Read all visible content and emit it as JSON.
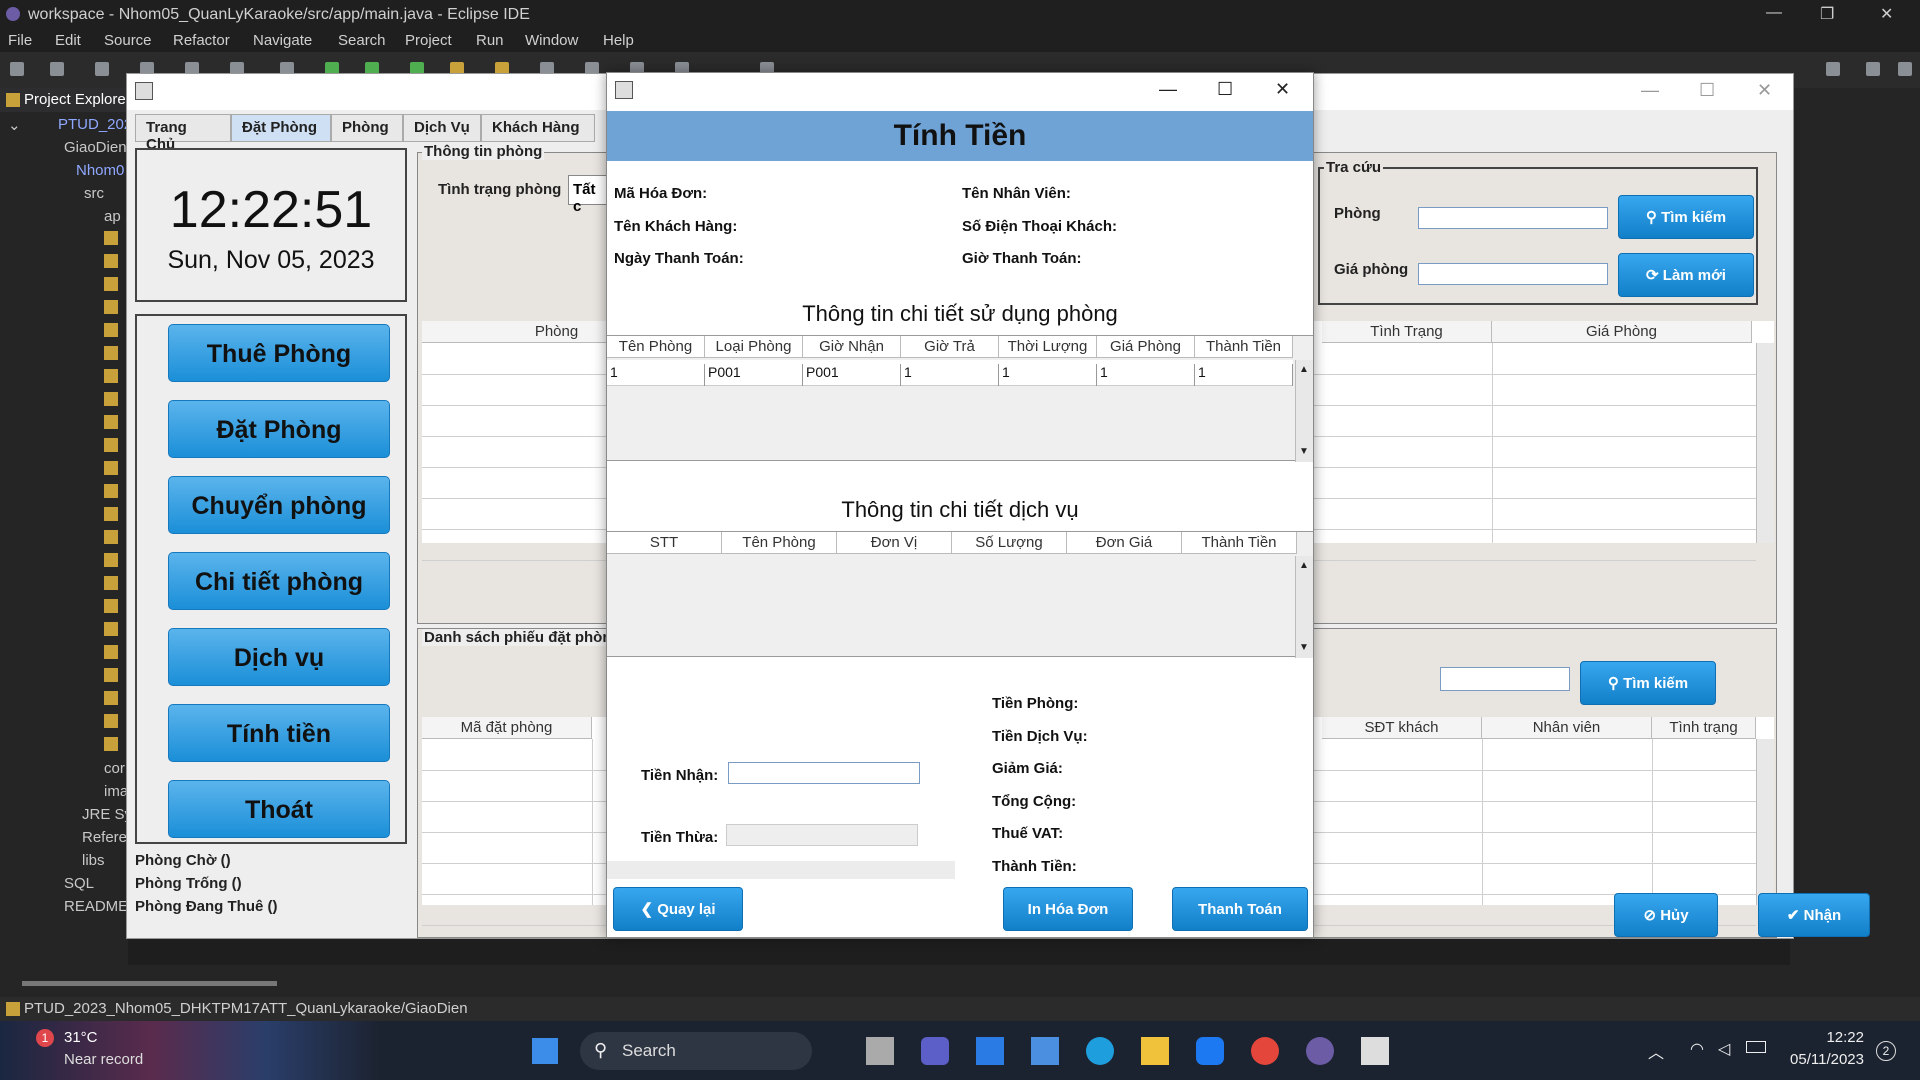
{
  "eclipse": {
    "window_title": "workspace - Nhom05_QuanLyKaraoke/src/app/main.java - Eclipse IDE",
    "menu": [
      "File",
      "Edit",
      "Source",
      "Refactor",
      "Navigate",
      "Search",
      "Project",
      "Run",
      "Window",
      "Help"
    ],
    "explorer_title": "Project Explore",
    "tree": [
      "PTUD_202",
      "GiaoDien",
      "Nhom0",
      "src",
      "ap",
      "cor",
      "ima",
      "JRE Sy",
      "Refere",
      "libs",
      "SQL",
      "README"
    ],
    "status_path": "PTUD_2023_Nhom05_DHKTPM17ATT_QuanLykaraoke/GiaoDien"
  },
  "app": {
    "tabs": [
      "Trang Chủ",
      "Đặt Phòng",
      "Phòng",
      "Dịch Vụ",
      "Khách Hàng"
    ],
    "selected_tab": "Đặt Phòng",
    "clock_time": "12:22:51",
    "clock_date": "Sun, Nov 05, 2023",
    "nav_buttons": [
      "Thuê Phòng",
      "Đặt Phòng",
      "Chuyển phòng",
      "Chi tiết phòng",
      "Dịch vụ",
      "Tính tiền",
      "Thoát"
    ],
    "room_status": [
      "Phòng Chờ ()",
      "Phòng Trống ()",
      "Phòng Đang Thuê ()"
    ],
    "room_info_title": "Thông tin phòng",
    "room_state_label": "Tình trạng phòng",
    "room_state_value": "Tất c",
    "room_grid_header": "Phòng",
    "lookup_title": "Tra cứu",
    "lookup_room_label": "Phòng",
    "lookup_price_label": "Giá phòng",
    "search_btn": "Tìm kiếm",
    "refresh_btn": "Làm mới",
    "right_grid_headers": [
      "Tình Trạng",
      "Giá Phòng"
    ],
    "booking_title": "Danh sách phiếu đặt phòn",
    "booking_headers": [
      "Mã đặt phòng",
      "SĐT khách",
      "Nhân viên",
      "Tình trạng"
    ],
    "booking_search_btn": "Tìm kiếm",
    "cancel_btn": "Hủy",
    "accept_btn": "Nhận"
  },
  "dialog": {
    "title": "Tính Tiền",
    "labels": {
      "invoice_id": "Mã Hóa Đơn:",
      "staff": "Tên Nhân Viên:",
      "customer": "Tên Khách Hàng:",
      "phone": "Số Điện Thoại Khách:",
      "pay_date": "Ngày Thanh Toán:",
      "pay_time": "Giờ Thanh Toán:"
    },
    "room_section": "Thông tin chi tiết sử dụng phòng",
    "room_headers": [
      "Tên Phòng",
      "Loại Phòng",
      "Giờ Nhận",
      "Giờ Trả",
      "Thời Lượng",
      "Giá Phòng",
      "Thành Tiền"
    ],
    "room_rows": [
      [
        "1",
        "P001",
        "P001",
        "1",
        "1",
        "1",
        "1"
      ]
    ],
    "service_section": "Thông tin chi tiết dịch vụ",
    "service_headers": [
      "STT",
      "Tên Phòng",
      "Đơn Vị",
      "Số Lượng",
      "Đơn Giá",
      "Thành Tiền"
    ],
    "received_label": "Tiền Nhận:",
    "change_label": "Tiền Thừa:",
    "totals": [
      "Tiền Phòng:",
      "Tiền Dịch Vụ:",
      "Giảm Giá:",
      "Tổng Cộng:",
      "Thuế VAT:",
      "Thành Tiền:"
    ],
    "back_btn": "Quay lại",
    "print_btn": "In Hóa Đơn",
    "pay_btn": "Thanh Toán"
  },
  "taskbar": {
    "temp": "31°C",
    "weather": "Near record",
    "search": "Search",
    "time": "12:22",
    "date": "05/11/2023",
    "notif": "2",
    "weather_badge": "1"
  }
}
